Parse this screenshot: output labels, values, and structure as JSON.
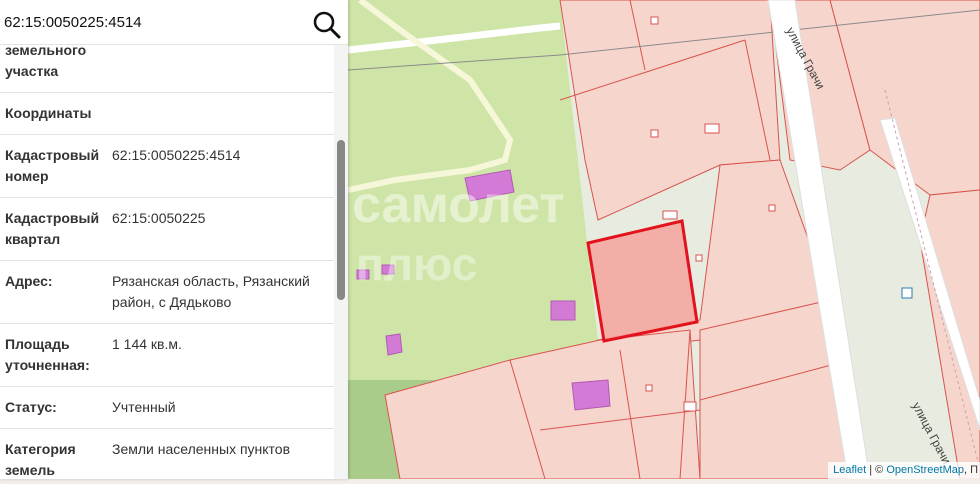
{
  "map": {
    "street_label": "улица Грачи",
    "selected_parcel_fill": "#f4a7a1",
    "selected_parcel_stroke": "#e3131d",
    "parcel_fill": "#f6d6cc",
    "parcel_stroke": "#d9534f",
    "building_fill": "#d27ad6",
    "green_area_color": "#cfe5a8",
    "road_color": "#ffffff"
  },
  "watermark": {
    "line1": "самолет",
    "line2": "плюс"
  },
  "search": {
    "value": "62:15:0050225:4514",
    "icon": "search-icon"
  },
  "details": [
    {
      "label": "земельного участка",
      "value": ""
    },
    {
      "label": "Координаты",
      "value": ""
    },
    {
      "label": "Кадастровый номер",
      "value": "62:15:0050225:4514"
    },
    {
      "label": "Кадастровый квартал",
      "value": "62:15:0050225"
    },
    {
      "label": "Адрес:",
      "value": "Рязанская область, Рязанский район, с Дядьково"
    },
    {
      "label": "Площадь уточненная:",
      "value": "1 144 кв.м."
    },
    {
      "label": "Статус:",
      "value": "Учтенный"
    },
    {
      "label": "Категория земель",
      "value": "Земли населенных пунктов"
    }
  ],
  "attribution": {
    "leaflet": "Leaflet",
    "separator": " | © ",
    "osm": "OpenStreetMap",
    "trail": ", П"
  }
}
